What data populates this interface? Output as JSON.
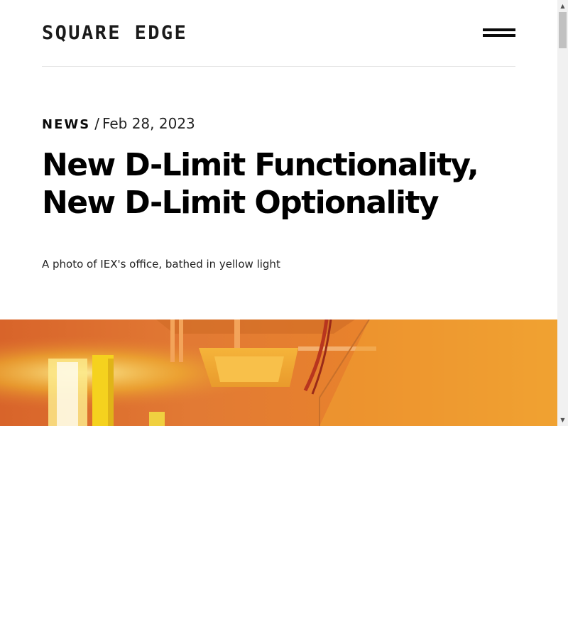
{
  "header": {
    "logo_text": "SQUARE EDGE",
    "menu_icon": "hamburger-menu-icon"
  },
  "article": {
    "category": "NEWS",
    "separator": "/",
    "date": "Feb 28, 2023",
    "title": "New D-Limit Functionality, New D-Limit Optionality",
    "image_caption": "A photo of IEX's office, bathed in yellow light"
  },
  "scrollbar": {
    "up_arrow": "▲",
    "down_arrow": "▼"
  },
  "colors": {
    "text": "#000000",
    "divider": "#e4e4e4",
    "hero_orange": "#e0782a",
    "hero_yellow": "#f5d21e"
  }
}
